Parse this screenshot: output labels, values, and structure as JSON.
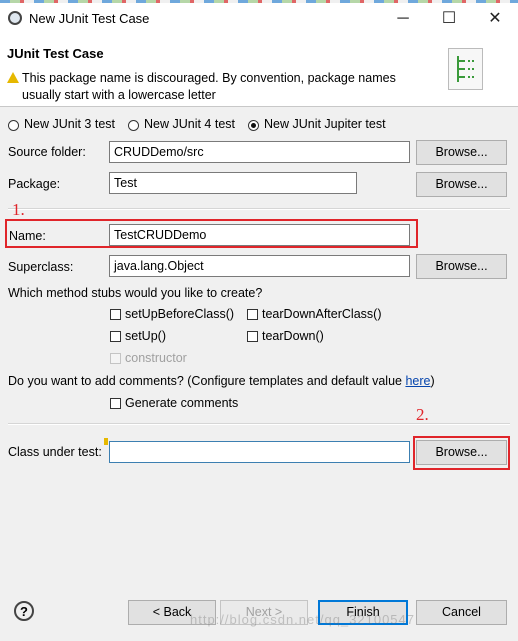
{
  "window": {
    "title": "New JUnit Test Case",
    "minimize": "─",
    "maximize": "☐",
    "close": "✕"
  },
  "header": {
    "title": "JUnit Test Case",
    "warning": "This package name is discouraged. By convention, package names usually start with a lowercase letter"
  },
  "radios": [
    {
      "label": "New JUnit 3 test",
      "selected": false
    },
    {
      "label": "New JUnit 4 test",
      "selected": false
    },
    {
      "label": "New JUnit Jupiter test",
      "selected": true
    }
  ],
  "fields": {
    "source_folder": {
      "label": "Source folder:",
      "value": "CRUDDemo/src",
      "button": "Browse..."
    },
    "package": {
      "label": "Package:",
      "value": "Test",
      "button": "Browse..."
    },
    "name": {
      "label": "Name:",
      "value": "TestCRUDDemo"
    },
    "superclass": {
      "label": "Superclass:",
      "value": "java.lang.Object",
      "button": "Browse..."
    }
  },
  "stubs": {
    "question": "Which method stubs would you like to create?",
    "options": [
      {
        "label": "setUpBeforeClass()",
        "checked": false,
        "enabled": true
      },
      {
        "label": "tearDownAfterClass()",
        "checked": false,
        "enabled": true
      },
      {
        "label": "setUp()",
        "checked": false,
        "enabled": true
      },
      {
        "label": "tearDown()",
        "checked": false,
        "enabled": true
      },
      {
        "label": "constructor",
        "checked": false,
        "enabled": false
      }
    ]
  },
  "comments": {
    "question": "Do you want to add comments? (Configure templates and default value ",
    "link": "here",
    "suffix": ")",
    "checkbox": "Generate comments"
  },
  "class_under_test": {
    "label": "Class under test:",
    "value": "",
    "button": "Browse..."
  },
  "annotations": {
    "step1": "1.",
    "step2": "2."
  },
  "footer": {
    "back": "< Back",
    "next": "Next >",
    "finish": "Finish",
    "cancel": "Cancel",
    "help_icon": "?"
  },
  "watermark": "http://blog.csdn.net/qq_32100547",
  "colors": {
    "annotation_red": "#e0252a",
    "link": "#0645ad",
    "default_button_border": "#0078d7"
  }
}
